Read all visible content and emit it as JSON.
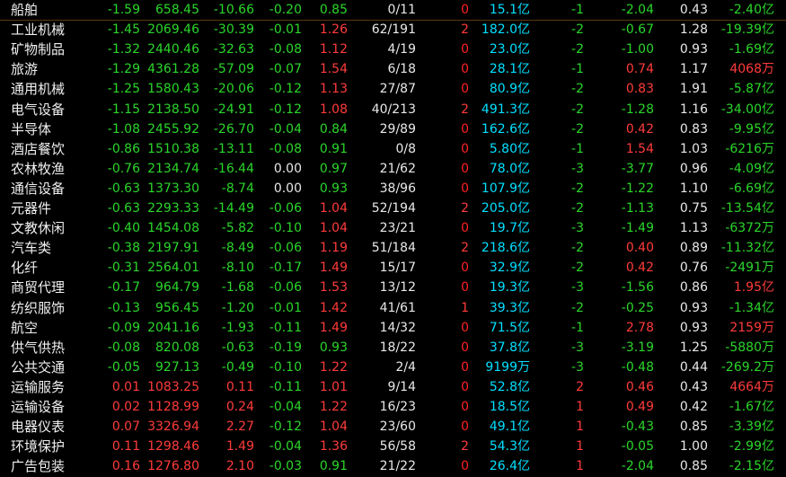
{
  "colors": {
    "up": "#ff3b3b",
    "down": "#2bd62b",
    "accent_cyan": "#00e0ff",
    "text": "#e8e8e8"
  },
  "rows": [
    [
      "船舶",
      "-1.59",
      "658.45",
      "-10.66",
      "-0.20",
      "0.85",
      "0/11",
      "0",
      "15.1亿",
      "-1",
      "-2.04",
      "0.43",
      "-2.40亿"
    ],
    [
      "工业机械",
      "-1.45",
      "2069.46",
      "-30.39",
      "-0.01",
      "1.26",
      "62/191",
      "2",
      "182.0亿",
      "-2",
      "-0.67",
      "1.28",
      "-19.39亿"
    ],
    [
      "矿物制品",
      "-1.32",
      "2440.46",
      "-32.63",
      "-0.08",
      "1.12",
      "4/19",
      "0",
      "23.0亿",
      "-2",
      "-1.00",
      "0.93",
      "-1.69亿"
    ],
    [
      "旅游",
      "-1.29",
      "4361.28",
      "-57.09",
      "-0.07",
      "1.54",
      "6/18",
      "0",
      "28.1亿",
      "-1",
      "0.74",
      "1.17",
      "4068万"
    ],
    [
      "通用机械",
      "-1.25",
      "1580.43",
      "-20.06",
      "-0.12",
      "1.13",
      "27/87",
      "0",
      "80.9亿",
      "-2",
      "0.83",
      "1.91",
      "-5.87亿"
    ],
    [
      "电气设备",
      "-1.15",
      "2138.50",
      "-24.91",
      "-0.12",
      "1.08",
      "40/213",
      "2",
      "491.3亿",
      "-2",
      "-1.28",
      "1.16",
      "-34.00亿"
    ],
    [
      "半导体",
      "-1.08",
      "2455.92",
      "-26.70",
      "-0.04",
      "0.84",
      "29/89",
      "0",
      "162.6亿",
      "-2",
      "0.42",
      "0.83",
      "-9.95亿"
    ],
    [
      "酒店餐饮",
      "-0.86",
      "1510.38",
      "-13.11",
      "-0.08",
      "0.91",
      "0/8",
      "0",
      "5.80亿",
      "-1",
      "1.54",
      "1.03",
      "-6216万"
    ],
    [
      "农林牧渔",
      "-0.76",
      "2134.74",
      "-16.44",
      "0.00",
      "0.97",
      "21/62",
      "0",
      "78.0亿",
      "-3",
      "-3.77",
      "0.96",
      "-4.09亿"
    ],
    [
      "通信设备",
      "-0.63",
      "1373.30",
      "-8.74",
      "0.00",
      "0.93",
      "38/96",
      "0",
      "107.9亿",
      "-2",
      "-1.22",
      "1.10",
      "-6.69亿"
    ],
    [
      "元器件",
      "-0.63",
      "2293.33",
      "-14.49",
      "-0.06",
      "1.04",
      "52/194",
      "2",
      "205.0亿",
      "-2",
      "-1.13",
      "0.75",
      "-13.54亿"
    ],
    [
      "文教休闲",
      "-0.40",
      "1454.08",
      "-5.82",
      "-0.10",
      "1.04",
      "23/21",
      "0",
      "19.7亿",
      "-3",
      "-1.49",
      "1.13",
      "-6372万"
    ],
    [
      "汽车类",
      "-0.38",
      "2197.91",
      "-8.49",
      "-0.06",
      "1.19",
      "51/184",
      "2",
      "218.6亿",
      "-2",
      "0.40",
      "0.89",
      "-11.32亿"
    ],
    [
      "化纤",
      "-0.31",
      "2564.01",
      "-8.10",
      "-0.17",
      "1.49",
      "15/17",
      "0",
      "32.9亿",
      "-2",
      "0.42",
      "0.76",
      "-2491万"
    ],
    [
      "商贸代理",
      "-0.17",
      "964.79",
      "-1.68",
      "-0.06",
      "1.53",
      "13/12",
      "0",
      "19.3亿",
      "-3",
      "-1.56",
      "0.86",
      "1.95亿"
    ],
    [
      "纺织服饰",
      "-0.13",
      "956.45",
      "-1.20",
      "-0.01",
      "1.42",
      "41/61",
      "1",
      "39.3亿",
      "-2",
      "-0.25",
      "0.93",
      "-1.34亿"
    ],
    [
      "航空",
      "-0.09",
      "2041.16",
      "-1.93",
      "-0.11",
      "1.49",
      "14/32",
      "0",
      "71.5亿",
      "-1",
      "2.78",
      "0.93",
      "2159万"
    ],
    [
      "供气供热",
      "-0.08",
      "820.08",
      "-0.63",
      "-0.19",
      "0.93",
      "18/22",
      "0",
      "37.8亿",
      "-3",
      "-3.19",
      "1.25",
      "-5880万"
    ],
    [
      "公共交通",
      "-0.05",
      "927.13",
      "-0.49",
      "-0.10",
      "1.22",
      "2/4",
      "0",
      "9199万",
      "-3",
      "-0.48",
      "0.44",
      "-269.2万"
    ],
    [
      "运输服务",
      "0.01",
      "1083.25",
      "0.11",
      "-0.11",
      "1.01",
      "9/14",
      "0",
      "52.8亿",
      "2",
      "0.46",
      "0.43",
      "4664万"
    ],
    [
      "运输设备",
      "0.02",
      "1128.99",
      "0.24",
      "-0.04",
      "1.22",
      "16/23",
      "0",
      "18.5亿",
      "1",
      "0.49",
      "0.42",
      "-1.67亿"
    ],
    [
      "电器仪表",
      "0.07",
      "3326.94",
      "2.27",
      "-0.12",
      "1.04",
      "23/60",
      "0",
      "49.1亿",
      "1",
      "-0.43",
      "0.85",
      "-3.39亿"
    ],
    [
      "环境保护",
      "0.11",
      "1298.46",
      "1.49",
      "-0.04",
      "1.36",
      "56/58",
      "2",
      "54.3亿",
      "1",
      "-0.05",
      "1.00",
      "-2.99亿"
    ],
    [
      "广告包装",
      "0.16",
      "1276.80",
      "2.10",
      "-0.03",
      "0.91",
      "21/22",
      "0",
      "26.4亿",
      "1",
      "-2.04",
      "0.85",
      "-2.15亿"
    ]
  ]
}
